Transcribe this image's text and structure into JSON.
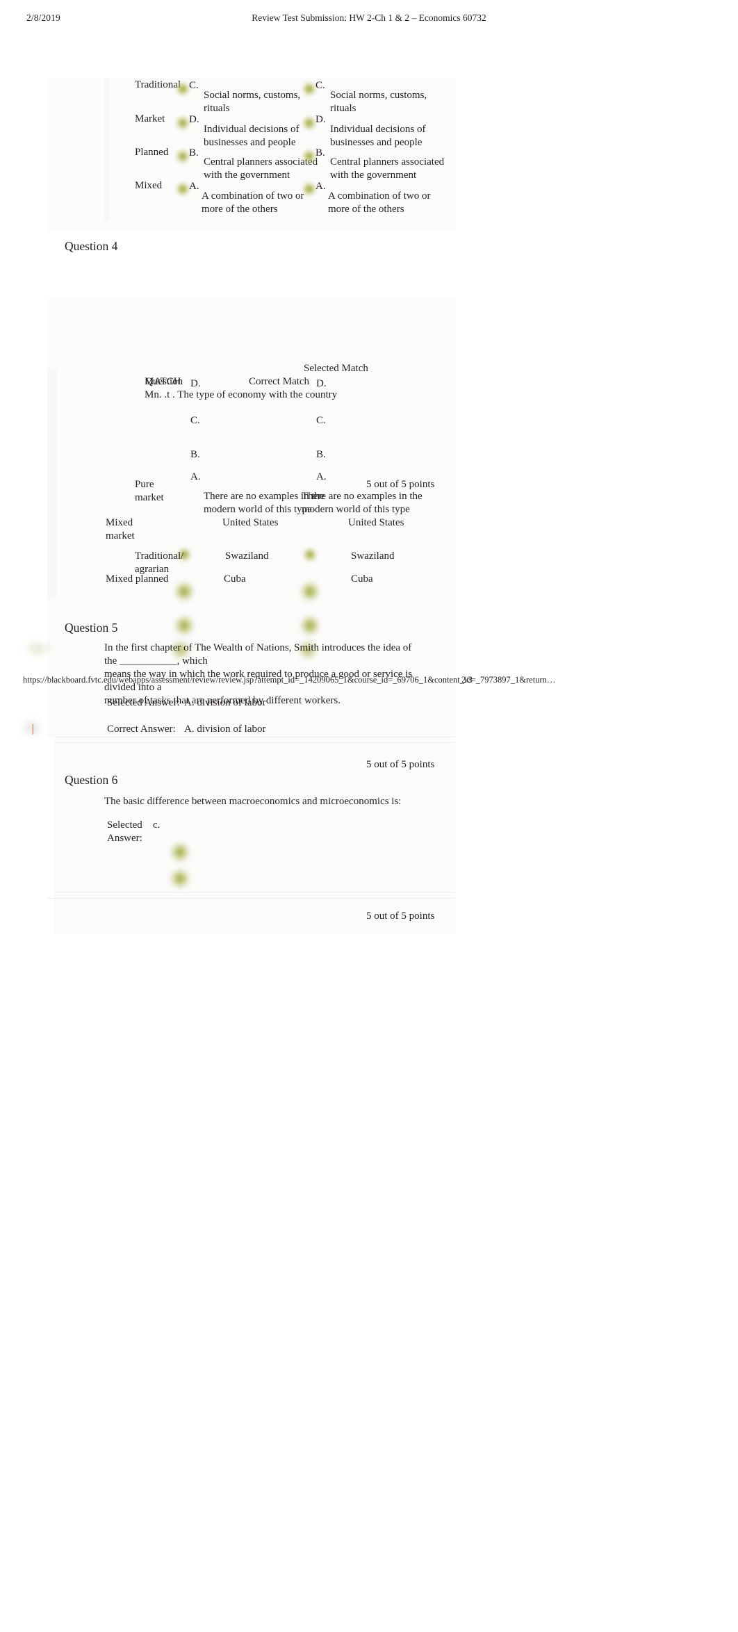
{
  "page": {
    "header_date": "2/8/2019",
    "header_title": "Review Test Submission: HW 2-Ch 1 & 2 – Economics 60732",
    "footer_url": "https://blackboard.fvtc.edu/webapps/assessment/review/review.jsp?attempt_id=_14209065_1&course_id=_69706_1&content_id=_7973897_1&return…",
    "footer_page": "2/3"
  },
  "q3_matching": {
    "rows": [
      {
        "term": "Traditional",
        "selected_letter": "C.",
        "selected_text": "Social norms, customs,\nrituals",
        "correct_letter": "C.",
        "correct_text": "Social norms, customs,\nrituals"
      },
      {
        "term": "Market",
        "selected_letter": "D.",
        "selected_text": "Individual decisions of\nbusinesses and people",
        "correct_letter": "D.",
        "correct_text": "Individual decisions of\nbusinesses and people"
      },
      {
        "term": "Planned",
        "selected_letter": "B.",
        "selected_text": "Central planners associated\nwith the government",
        "correct_letter": "B.",
        "correct_text": "Central planners associated\nwith the government"
      },
      {
        "term": "Mixed",
        "selected_letter": "A.",
        "selected_text": " A combination of two or\nmore of the others",
        "correct_letter": "A.",
        "correct_text": " A combination of two or\nmore of the others"
      }
    ]
  },
  "q4": {
    "heading": "Question 4",
    "points": "5 out of 5 points",
    "overlap_layers": {
      "layer_a": "MATCH",
      "layer_b": "Question",
      "layer_c": "Mn. .t . The type of economy with the country",
      "layer_d": "Correct Match",
      "tail": " the country"
    },
    "col_correct_header": "Correct Match",
    "col_selected_header": "Selected Match",
    "letters_correct": [
      "D.",
      "C.",
      "B.",
      "A."
    ],
    "letters_selected": [
      "D.",
      "C.",
      "B.",
      "A."
    ],
    "rows": [
      {
        "term": "Pure\nmarket",
        "correct_text": "There are no examples in the\nmodern world of this type",
        "selected_text": "There are no examples in the\nmodern world of this type"
      },
      {
        "term": "Mixed\nmarket",
        "correct_text": "United States",
        "selected_text": "United States"
      },
      {
        "term": "Traditional/\nagrarian",
        "correct_text": "Swaziland",
        "selected_text": "Swaziland"
      },
      {
        "term": "Mixed  planned",
        "correct_text": "Cuba",
        "selected_text": "Cuba"
      }
    ]
  },
  "q5": {
    "heading": "Question 5",
    "points": "5 out of 5 points",
    "prompt": "In the first chapter of The Wealth of Nations, Smith introduces the idea of the ___________, which\nmeans the way in which the work required to produce a good or service is divided into a\nnumber of tasks that are performed by different workers.",
    "selected_label": "Selected Answer:",
    "selected_value": "A. division of labor",
    "correct_label": "Correct Answer:",
    "correct_value": "A. division of labor"
  },
  "q6": {
    "heading": "Question 6",
    "points": "5 out of 5 points",
    "prompt": "The basic difference between macroeconomics and microeconomics is:",
    "selected_label": "Selected\nAnswer:",
    "selected_value": "c."
  },
  "colors": {
    "ink": "#231f20",
    "answer_dot": "#96a028",
    "mark": "#e2712a",
    "band": "#fbfbfa"
  }
}
